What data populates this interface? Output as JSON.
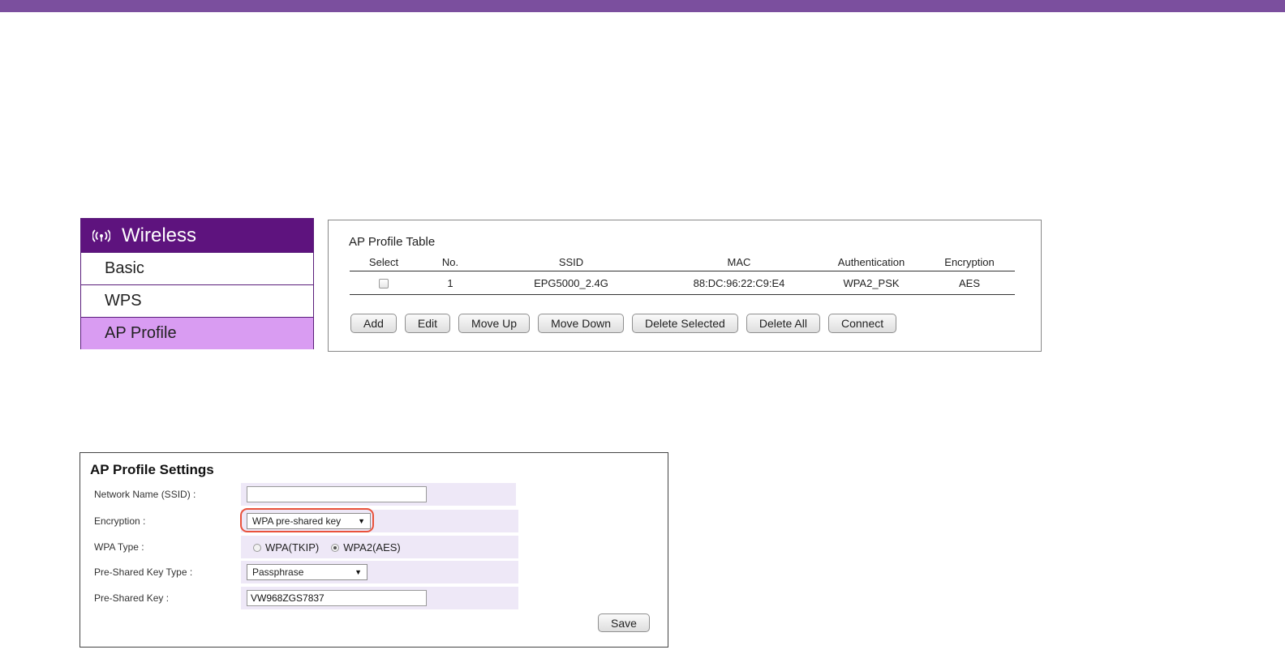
{
  "sidebar": {
    "title": "Wireless",
    "items": [
      {
        "label": "Basic"
      },
      {
        "label": "WPS"
      },
      {
        "label": "AP Profile"
      }
    ],
    "icon": "wireless-icon",
    "accent": "#5e137e",
    "active_bg": "#d99cf2"
  },
  "profile_table": {
    "title": "AP Profile Table",
    "headers": {
      "select": "Select",
      "no": "No.",
      "ssid": "SSID",
      "mac": "MAC",
      "authentication": "Authentication",
      "encryption": "Encryption"
    },
    "rows": [
      {
        "no": "1",
        "ssid": "EPG5000_2.4G",
        "mac": "88:DC:96:22:C9:E4",
        "authentication": "WPA2_PSK",
        "encryption": "AES"
      }
    ],
    "buttons": {
      "add": "Add",
      "edit": "Edit",
      "move_up": "Move Up",
      "move_down": "Move Down",
      "delete_selected": "Delete Selected",
      "delete_all": "Delete All",
      "connect": "Connect"
    }
  },
  "settings": {
    "title": "AP Profile Settings",
    "ssid_label": "Network Name (SSID) :",
    "ssid_value": "",
    "encryption_label": "Encryption :",
    "encryption_value": "WPA pre-shared key",
    "wpa_type_label": "WPA Type :",
    "wpa_options": [
      "WPA(TKIP)",
      "WPA2(AES)"
    ],
    "wpa_selected": "WPA2(AES)",
    "psk_type_label": "Pre-Shared Key Type :",
    "psk_type_value": "Passphrase",
    "psk_label": "Pre-Shared Key :",
    "psk_value": "VW968ZGS7837",
    "save_label": "Save",
    "highlight_color": "#e9523c"
  },
  "colors": {
    "header_bar": "#7b4f9e",
    "field_bg": "#eee8f7"
  }
}
